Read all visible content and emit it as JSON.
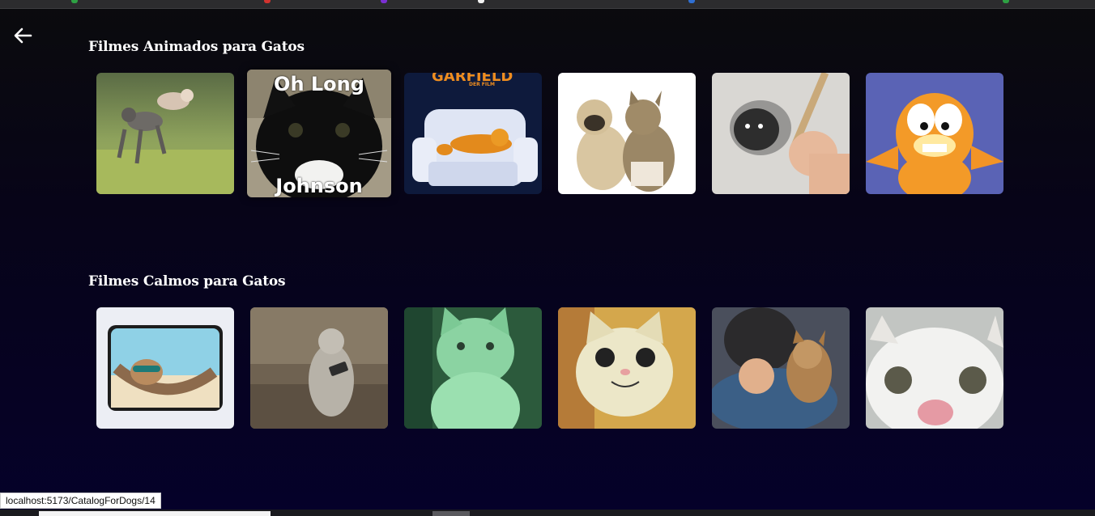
{
  "browser": {
    "status_url": "localhost:5173/CatalogForDogs/14"
  },
  "nav": {
    "back_icon": "arrow-left-icon"
  },
  "sections": [
    {
      "title": "Filmes Animados para Gatos",
      "items": [
        {
          "subject": "two cats leaping on grass"
        },
        {
          "subject": "black cat poster",
          "caption_top": "Oh Long",
          "caption_bottom": "Johnson"
        },
        {
          "subject": "Garfield on armchair poster",
          "caption_top": "GARFIELD",
          "caption_sub": "DER FILM"
        },
        {
          "subject": "pug and tabby cat"
        },
        {
          "subject": "drawing of fluffy cat with pen"
        },
        {
          "subject": "Garfield cartoon"
        }
      ]
    },
    {
      "title": "Filmes Calmos para Gatos",
      "items": [
        {
          "subject": "cat in hammock with sunglasses"
        },
        {
          "subject": "cat sitting with phone on couch"
        },
        {
          "subject": "night vision cat"
        },
        {
          "subject": "smiling cat meme"
        },
        {
          "subject": "kitten on shoulder"
        },
        {
          "subject": "close-up cat face"
        }
      ]
    }
  ],
  "colors": {
    "background_top": "#0b0b0d",
    "background_bottom": "#05012a",
    "text": "#ffffff"
  }
}
